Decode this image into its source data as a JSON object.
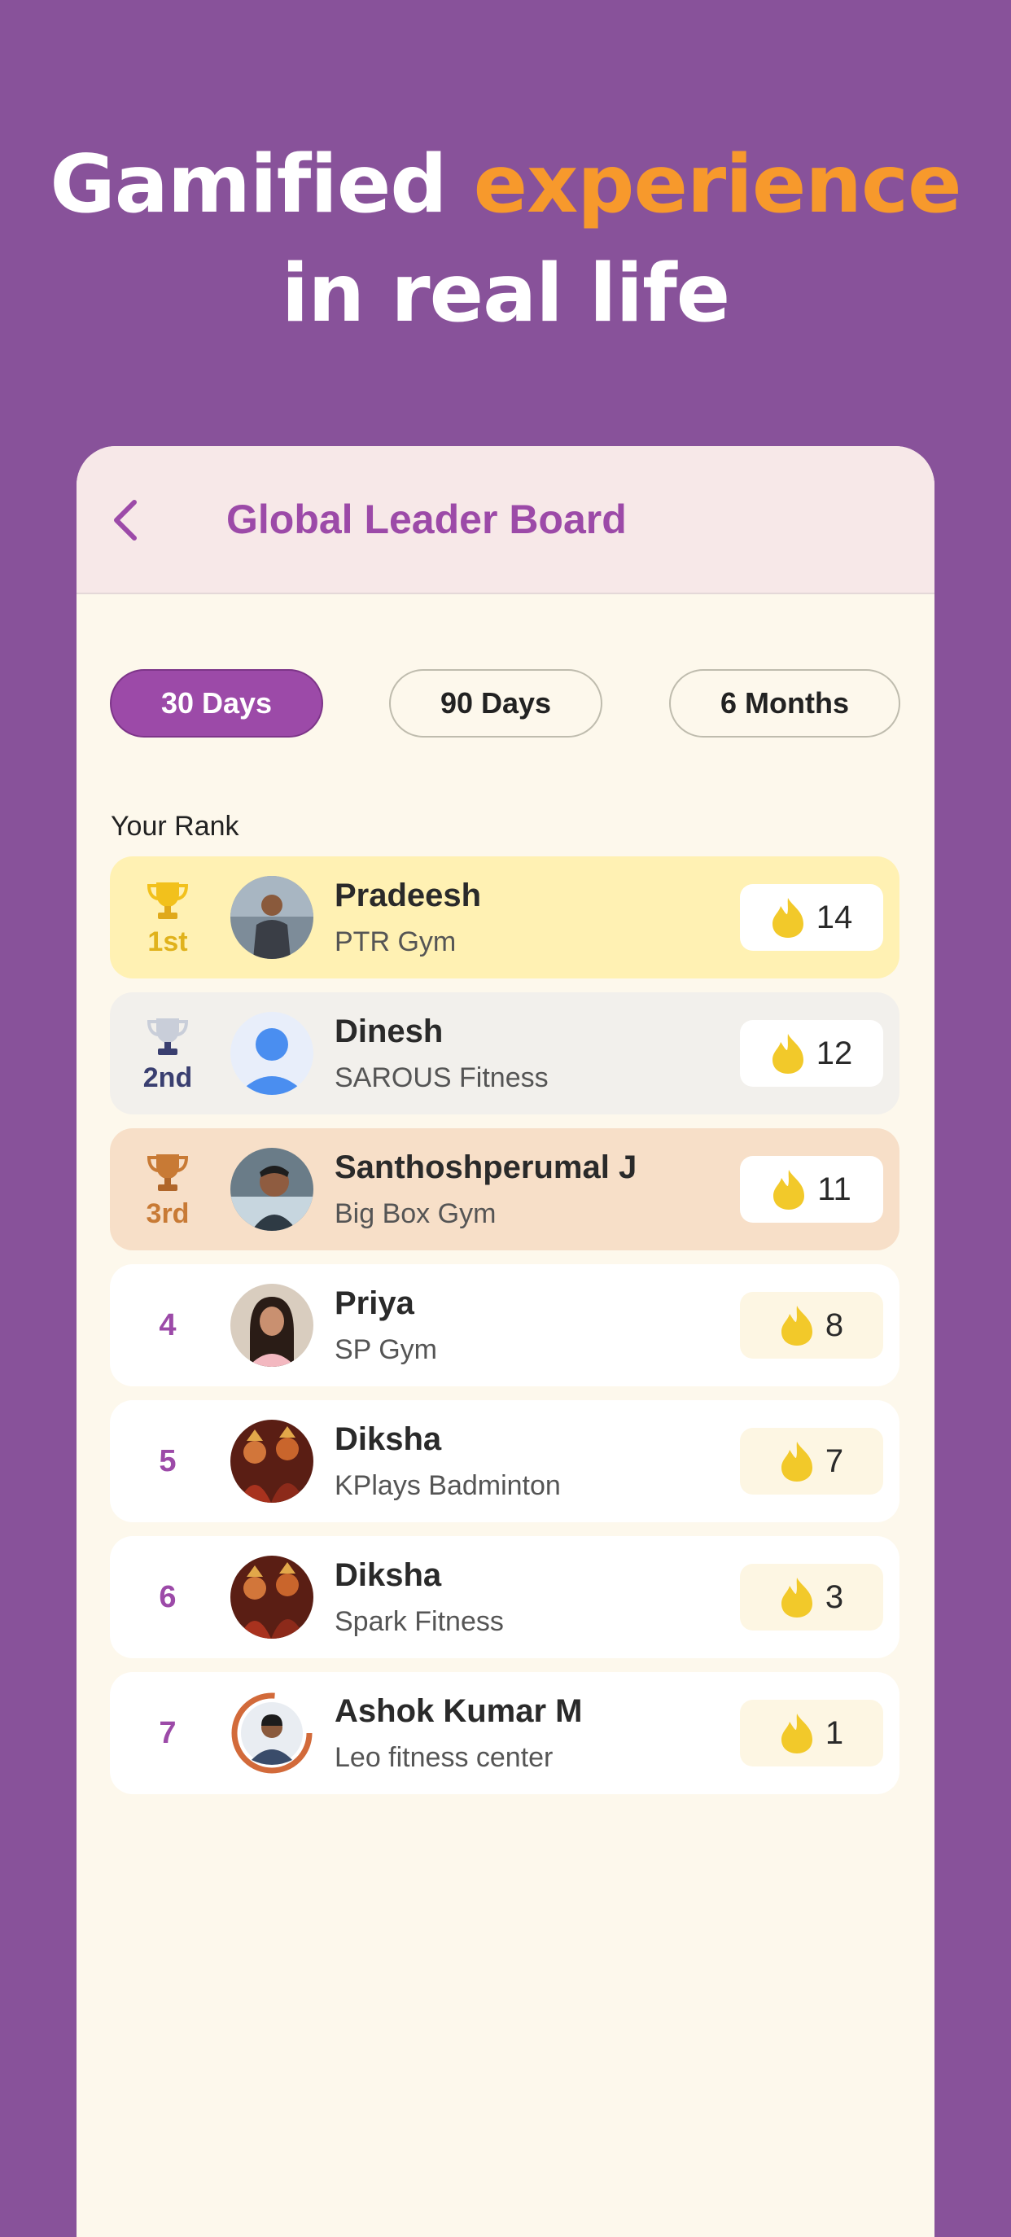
{
  "hero": {
    "line1_prefix": "Gamified ",
    "line1_accent": "experience",
    "line2": "in real life"
  },
  "appbar": {
    "title": "Global Leader Board"
  },
  "filters": [
    {
      "label": "30 Days",
      "active": true
    },
    {
      "label": "90 Days",
      "active": false
    },
    {
      "label": "6 Months",
      "active": false
    }
  ],
  "your_rank_label": "Your Rank",
  "leaders": [
    {
      "rank": "1st",
      "name": "Pradeesh",
      "gym": "PTR Gym",
      "score": "14",
      "medal": "gold"
    },
    {
      "rank": "2nd",
      "name": "Dinesh",
      "gym": "SAROUS Fitness",
      "score": "12",
      "medal": "silver"
    },
    {
      "rank": "3rd",
      "name": "Santhoshperumal J",
      "gym": "Big Box Gym",
      "score": "11",
      "medal": "bronze"
    },
    {
      "rank": "4",
      "name": "Priya",
      "gym": "SP Gym",
      "score": "8"
    },
    {
      "rank": "5",
      "name": "Diksha",
      "gym": "KPlays Badminton",
      "score": "7"
    },
    {
      "rank": "6",
      "name": "Diksha",
      "gym": "Spark Fitness",
      "score": "3"
    },
    {
      "rank": "7",
      "name": "Ashok Kumar M",
      "gym": "Leo fitness center",
      "score": "1"
    }
  ],
  "colors": {
    "background": "#88529a",
    "accent_orange": "#f7992c",
    "primary_purple": "#9c4aa8",
    "gold": "#e0b21c",
    "silver": "#c5cad6",
    "bronze": "#c87a35",
    "flame": "#f2c92a"
  }
}
